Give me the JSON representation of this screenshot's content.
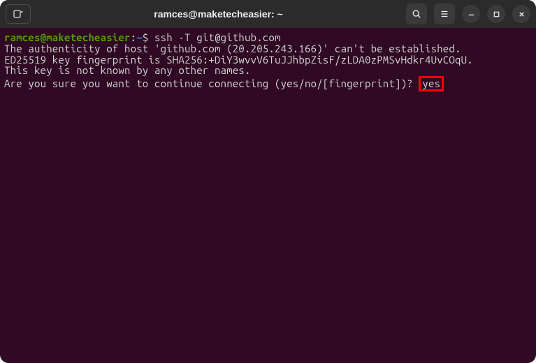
{
  "titlebar": {
    "title": "ramces@maketecheasier: ~"
  },
  "prompt": {
    "user_host": "ramces@maketecheasier",
    "sep": ":",
    "path": "~",
    "dollar": "$ "
  },
  "terminal": {
    "command": "ssh -T git@github.com",
    "line1": "The authenticity of host 'github.com (20.205.243.166)' can't be established.",
    "line2": "ED25519 key fingerprint is SHA256:+DiY3wvvV6TuJJhbpZisF/zLDA0zPMSvHdkr4UvCOqU.",
    "line3": "This key is not known by any other names.",
    "line4": "Are you sure you want to continue connecting (yes/no/[fingerprint])? ",
    "response": "yes"
  }
}
